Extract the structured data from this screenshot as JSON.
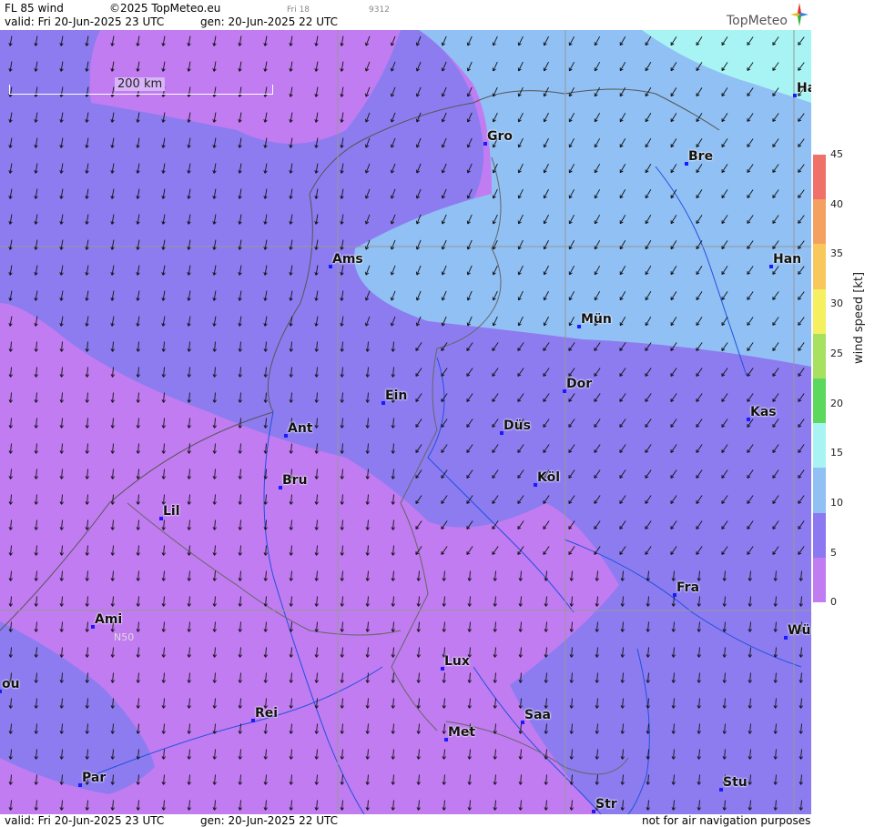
{
  "header": {
    "product": "FL 85 wind",
    "copyright": "©2025 TopMeteo.eu",
    "day_label": "Fri 18",
    "run_code": "9312",
    "valid": "valid:  Fri  20-Jun-2025  23 UTC",
    "gen": "gen: 20-Jun-2025 22 UTC"
  },
  "footer": {
    "valid": "valid:  Fri  20-Jun-2025  23 UTC",
    "gen": "gen: 20-Jun-2025 22 UTC",
    "disclaimer": "not for air navigation purposes"
  },
  "logo": {
    "text": "TopMeteo",
    "icon": "compass-star-icon"
  },
  "map": {
    "scale_label": "200 km",
    "latitude_label": "N50",
    "cities": [
      {
        "name": "Ha"
      },
      {
        "name": "Gro"
      },
      {
        "name": "Bre"
      },
      {
        "name": "Ams"
      },
      {
        "name": "Han"
      },
      {
        "name": "Mün"
      },
      {
        "name": "Dor"
      },
      {
        "name": "Ein"
      },
      {
        "name": "Kas"
      },
      {
        "name": "Ant"
      },
      {
        "name": "Düs"
      },
      {
        "name": "Köl"
      },
      {
        "name": "Bru"
      },
      {
        "name": "Lil"
      },
      {
        "name": "Fra"
      },
      {
        "name": "Ami"
      },
      {
        "name": "Wü"
      },
      {
        "name": "Lux"
      },
      {
        "name": "ou"
      },
      {
        "name": "Rei"
      },
      {
        "name": "Saa"
      },
      {
        "name": "Met"
      },
      {
        "name": "Par"
      },
      {
        "name": "Stu"
      },
      {
        "name": "Str"
      }
    ]
  },
  "legend": {
    "title": "wind  speed  [kt]",
    "ticks": [
      "45",
      "40",
      "35",
      "30",
      "25",
      "20",
      "15",
      "10",
      "5",
      "0"
    ],
    "colors": [
      "#f0706a",
      "#f4a060",
      "#f8c85c",
      "#f4f060",
      "#a8e060",
      "#5cd85c",
      "#a8f4f4",
      "#90c0f4",
      "#8c78f0",
      "#c07cf0"
    ]
  }
}
